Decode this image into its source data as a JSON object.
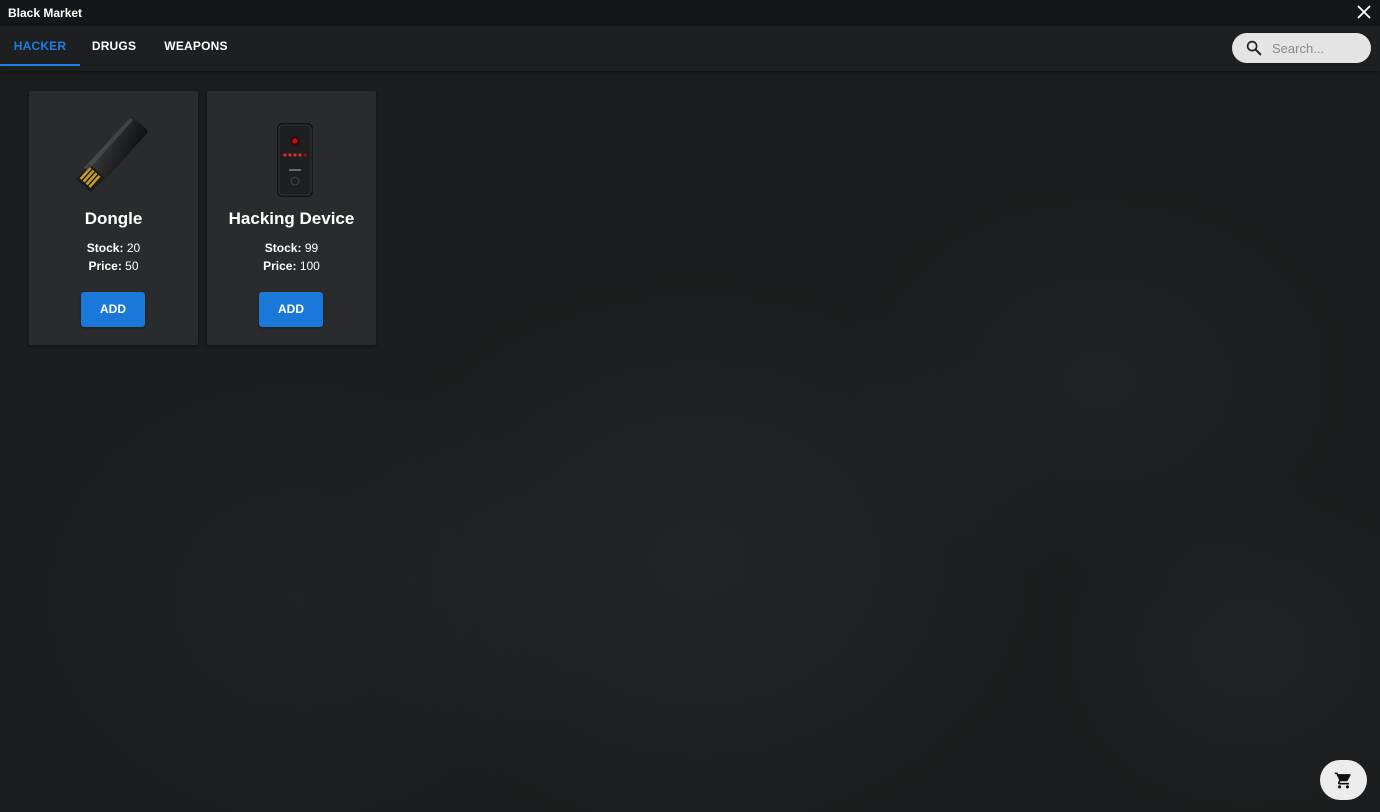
{
  "window": {
    "title": "Black Market"
  },
  "tabs": [
    {
      "label": "HACKER",
      "active": true
    },
    {
      "label": "DRUGS",
      "active": false
    },
    {
      "label": "WEAPONS",
      "active": false
    }
  ],
  "search": {
    "placeholder": "Search...",
    "value": "",
    "icon": "search-icon"
  },
  "items": [
    {
      "name": "Dongle",
      "stock_label": "Stock:",
      "stock": "20",
      "price_label": "Price:",
      "price": "50",
      "button": "ADD",
      "icon": "usb-dongle-icon"
    },
    {
      "name": "Hacking Device",
      "stock_label": "Stock:",
      "stock": "99",
      "price_label": "Price:",
      "price": "100",
      "button": "ADD",
      "icon": "hacking-device-icon"
    }
  ],
  "colors": {
    "accent": "#1e7fe0",
    "button": "#1a78d8",
    "card": "#2a2b2c",
    "background": "#1c1d1e"
  },
  "cart": {
    "icon": "cart-icon"
  },
  "close": {
    "icon": "close-icon"
  }
}
